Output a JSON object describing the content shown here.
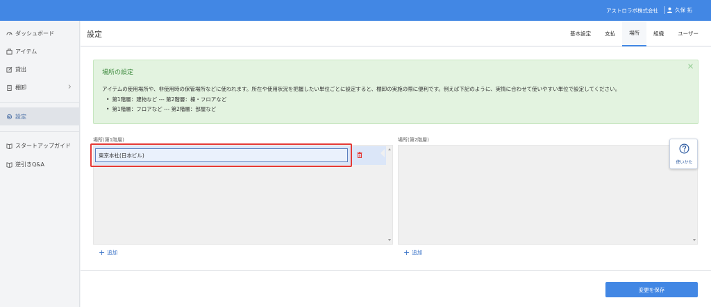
{
  "topbar": {
    "company": "アストロラボ株式会社",
    "user": "久保 拓"
  },
  "sidebar": {
    "items": [
      {
        "label": "ダッシュボード",
        "icon": "gauge-icon"
      },
      {
        "label": "アイテム",
        "icon": "box-icon"
      },
      {
        "label": "貸出",
        "icon": "edit-icon"
      },
      {
        "label": "棚卸",
        "icon": "clipboard-icon"
      },
      {
        "label": "設定",
        "icon": "gear-icon"
      },
      {
        "label": "スタートアップガイド",
        "icon": "book-icon"
      },
      {
        "label": "逆引きQ&A",
        "icon": "book-icon"
      }
    ],
    "active": "設定"
  },
  "header": {
    "title": "設定",
    "tabs": [
      "基本設定",
      "支払",
      "場所",
      "組織",
      "ユーザー"
    ],
    "active_tab": "場所"
  },
  "info": {
    "title": "場所の設定",
    "description": "アイテムの使用場所や、非使用時の保管場所などに使われます。所在や使用状況を把握したい単位ごとに設定すると、棚卸の実施の際に便利です。例えば下記のように、実情に合わせて使いやすい単位で設定してください。",
    "bullets": [
      "第1階層：建物など --- 第2階層：棟・フロアなど",
      "第1階層：フロアなど --- 第2階層：部屋など"
    ]
  },
  "level1": {
    "label": "場所(第1階層)",
    "items": [
      "東京本社(日本ビル)"
    ],
    "add_label": "追加"
  },
  "level2": {
    "label": "場所(第2階層)",
    "add_label": "追加"
  },
  "help": {
    "label": "使いかた"
  },
  "save_label": "変更を保存",
  "colors": {
    "primary": "#4287e4",
    "info_bg": "#e3f3e0",
    "info_title": "#3c8a3c",
    "highlight": "#e53935",
    "danger": "#e53935"
  }
}
